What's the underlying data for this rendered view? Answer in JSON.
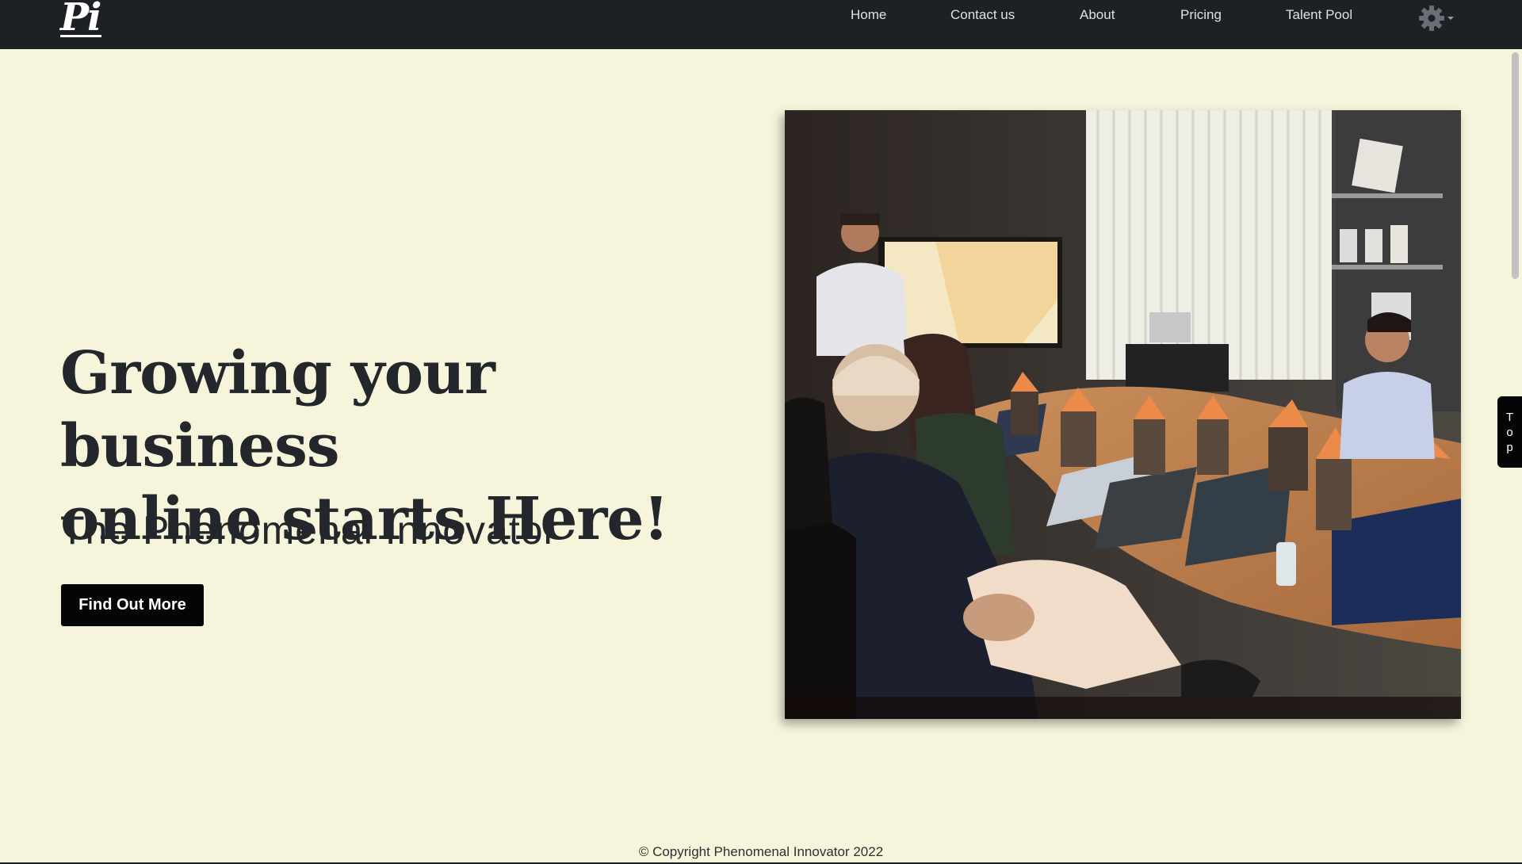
{
  "navbar": {
    "logo": "Pi",
    "links": [
      {
        "label": "Home"
      },
      {
        "label": "Contact us"
      },
      {
        "label": "About"
      },
      {
        "label": "Pricing"
      },
      {
        "label": "Talent Pool"
      }
    ],
    "settings_icon": "gear-icon"
  },
  "hero": {
    "title_line1": "Growing your business",
    "title_line2": "online starts Here!",
    "subtitle": "The Phenomenal Innovator",
    "cta_label": "Find Out More"
  },
  "top_button": {
    "letters": [
      "T",
      "o",
      "p"
    ]
  },
  "footer": {
    "copyright": "© Copyright Phenomenal Innovator 2022"
  },
  "colors": {
    "navbar_bg": "#1d2126",
    "page_bg": "#f6f5dc",
    "button_bg": "#050505",
    "text": "#23262b"
  }
}
